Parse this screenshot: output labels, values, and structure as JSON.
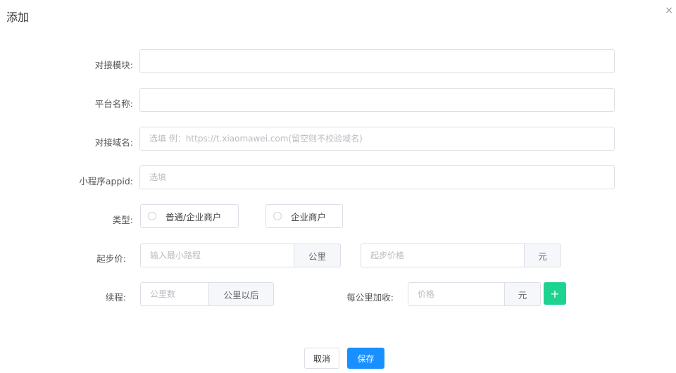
{
  "dialog": {
    "title": "添加",
    "close_glyph": "×"
  },
  "fields": {
    "module": {
      "label": "对接模块:",
      "value": "",
      "placeholder": ""
    },
    "platform_name": {
      "label": "平台名称:",
      "value": "",
      "placeholder": ""
    },
    "domain": {
      "label": "对接域名:",
      "value": "",
      "placeholder": "选填 例：https://t.xiaomawei.com(留空则不校验域名)"
    },
    "appid": {
      "label": "小程序appid:",
      "value": "",
      "placeholder": "选填"
    },
    "type": {
      "label": "类型:",
      "options": [
        "普通/企业商户",
        "企业商户"
      ]
    },
    "start_price": {
      "label": "起步价:",
      "distance_placeholder": "输入最小路程",
      "distance_unit": "公里",
      "price_placeholder": "起步价格",
      "price_unit": "元"
    },
    "continue": {
      "label": "续程:",
      "distance_placeholder": "公里数",
      "distance_unit": "公里以后",
      "per_km_label": "每公里加收:",
      "price_placeholder": "价格",
      "price_unit": "元",
      "add_glyph": "+"
    }
  },
  "footer": {
    "cancel_label": "取消",
    "save_label": "保存"
  },
  "colors": {
    "save": "#1890ff",
    "add": "#1ed28f"
  }
}
